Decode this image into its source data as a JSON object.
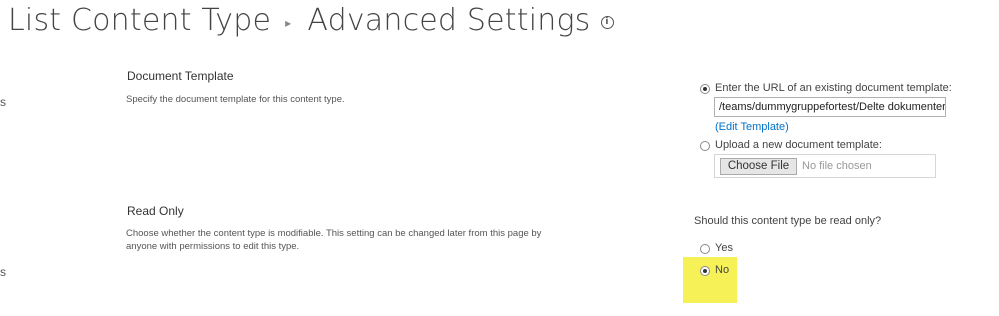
{
  "header": {
    "breadcrumb_parent": "List Content Type",
    "separator": "▸",
    "title": "Advanced Settings",
    "info_icon": "ⓘ"
  },
  "edge_glyphs": [
    "s",
    "s"
  ],
  "document_template": {
    "title": "Document Template",
    "description": "Specify the document template for this content type.",
    "url_option_label": "Enter the URL of an existing document template:",
    "url_value": "/teams/dummygruppefortest/Delte dokumenter",
    "edit_link": "(Edit Template)",
    "upload_option_label": "Upload a new document template:",
    "choose_file_label": "Choose File",
    "file_status": "No file chosen",
    "selected_option": "url"
  },
  "read_only": {
    "title": "Read Only",
    "description_line1": "Choose whether the content type is modifiable. This setting can be changed later from this page by",
    "description_line2": "anyone with permissions to edit this type.",
    "question": "Should this content type be read only?",
    "option_yes": "Yes",
    "option_no": "No",
    "selected_option": "No"
  },
  "colors": {
    "link": "#0072c6",
    "highlight": "#f6f04a"
  }
}
